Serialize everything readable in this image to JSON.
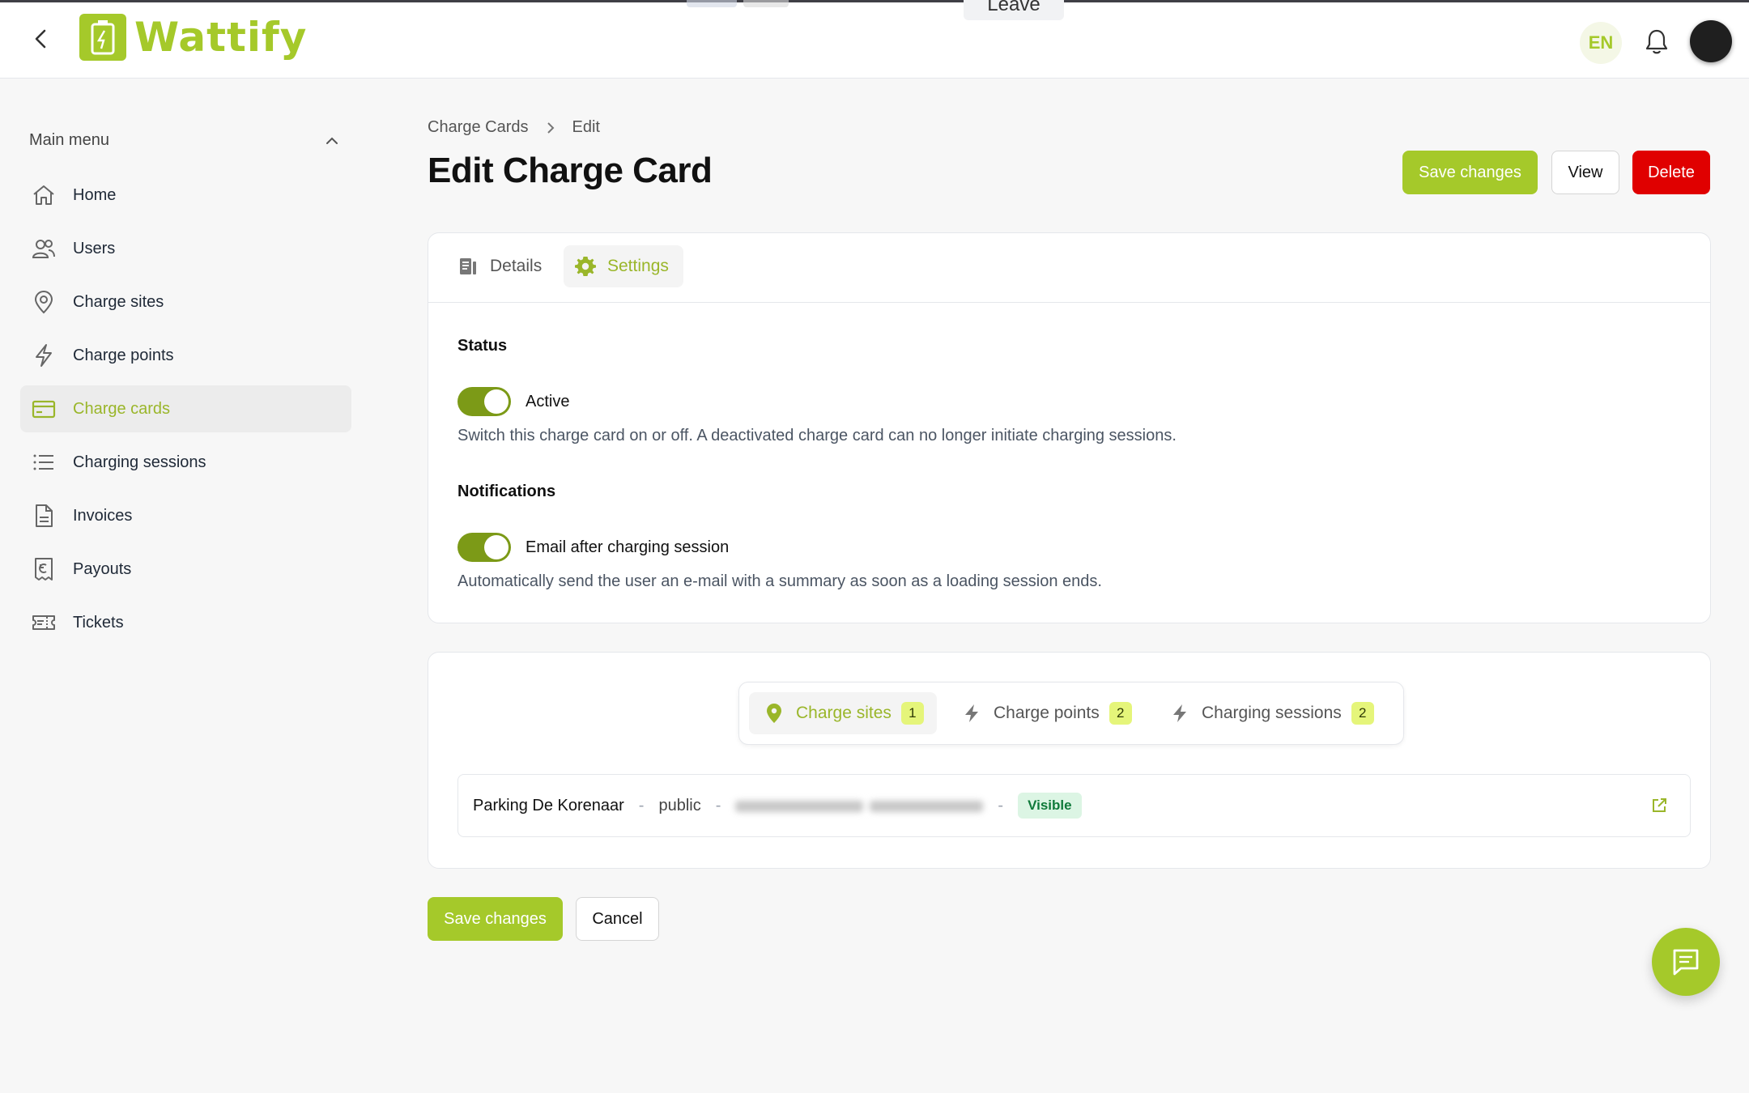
{
  "app": {
    "name": "Wattify"
  },
  "topbar": {
    "leave_label": "Leave",
    "language": "EN"
  },
  "sidebar": {
    "heading": "Main menu",
    "items": [
      {
        "label": "Home",
        "icon": "home-icon"
      },
      {
        "label": "Users",
        "icon": "users-icon"
      },
      {
        "label": "Charge sites",
        "icon": "map-pin-icon"
      },
      {
        "label": "Charge points",
        "icon": "lightning-icon"
      },
      {
        "label": "Charge cards",
        "icon": "credit-card-icon",
        "active": true
      },
      {
        "label": "Charging sessions",
        "icon": "list-icon"
      },
      {
        "label": "Invoices",
        "icon": "document-icon"
      },
      {
        "label": "Payouts",
        "icon": "receipt-icon"
      },
      {
        "label": "Tickets",
        "icon": "ticket-icon"
      }
    ]
  },
  "breadcrumb": {
    "parent": "Charge Cards",
    "current": "Edit"
  },
  "page": {
    "title": "Edit Charge Card"
  },
  "actions": {
    "save": "Save changes",
    "view": "View",
    "delete": "Delete"
  },
  "tabs": [
    {
      "label": "Details",
      "icon": "document-icon"
    },
    {
      "label": "Settings",
      "icon": "gear-icon",
      "active": true
    }
  ],
  "settings": {
    "status": {
      "title": "Status",
      "toggle_label": "Active",
      "enabled": true,
      "help": "Switch this charge card on or off. A deactivated charge card can no longer initiate charging sessions."
    },
    "notifications": {
      "title": "Notifications",
      "toggle_label": "Email after charging session",
      "enabled": true,
      "help": "Automatically send the user an e-mail with a summary as soon as a loading session ends."
    }
  },
  "relations": {
    "tabs": [
      {
        "label": "Charge sites",
        "count": "1",
        "icon": "map-pin-icon",
        "active": true
      },
      {
        "label": "Charge points",
        "count": "2",
        "icon": "lightning-icon"
      },
      {
        "label": "Charging sessions",
        "count": "2",
        "icon": "lightning-icon"
      }
    ],
    "rows": [
      {
        "name": "Parking De Korenaar",
        "type": "public",
        "badge": "Visible"
      }
    ]
  },
  "footer": {
    "save": "Save changes",
    "cancel": "Cancel"
  },
  "colors": {
    "brand": "#a5c92a",
    "toggle_on": "#7c9a17",
    "danger": "#e00000",
    "badge_bg": "#dcf5e4",
    "count_bg": "#e5f57a"
  }
}
